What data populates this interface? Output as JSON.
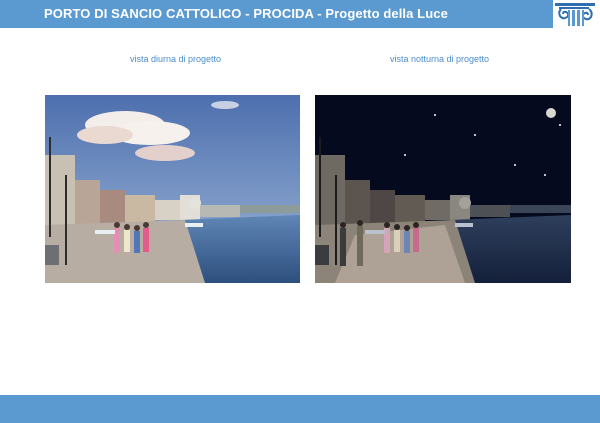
{
  "header": {
    "title": "PORTO DI SANCIO CATTOLICO - PROCIDA - Progetto della Luce",
    "logo_icon": "column-capital-logo-icon"
  },
  "captions": {
    "day": "vista diurna di progetto",
    "night": "vista notturna di progetto"
  },
  "photos": {
    "day": {
      "icon": "harbor-day-photo"
    },
    "night": {
      "icon": "harbor-night-photo"
    }
  },
  "colors": {
    "brand_blue": "#5b9ad0",
    "caption_blue": "#4a8fcf"
  }
}
